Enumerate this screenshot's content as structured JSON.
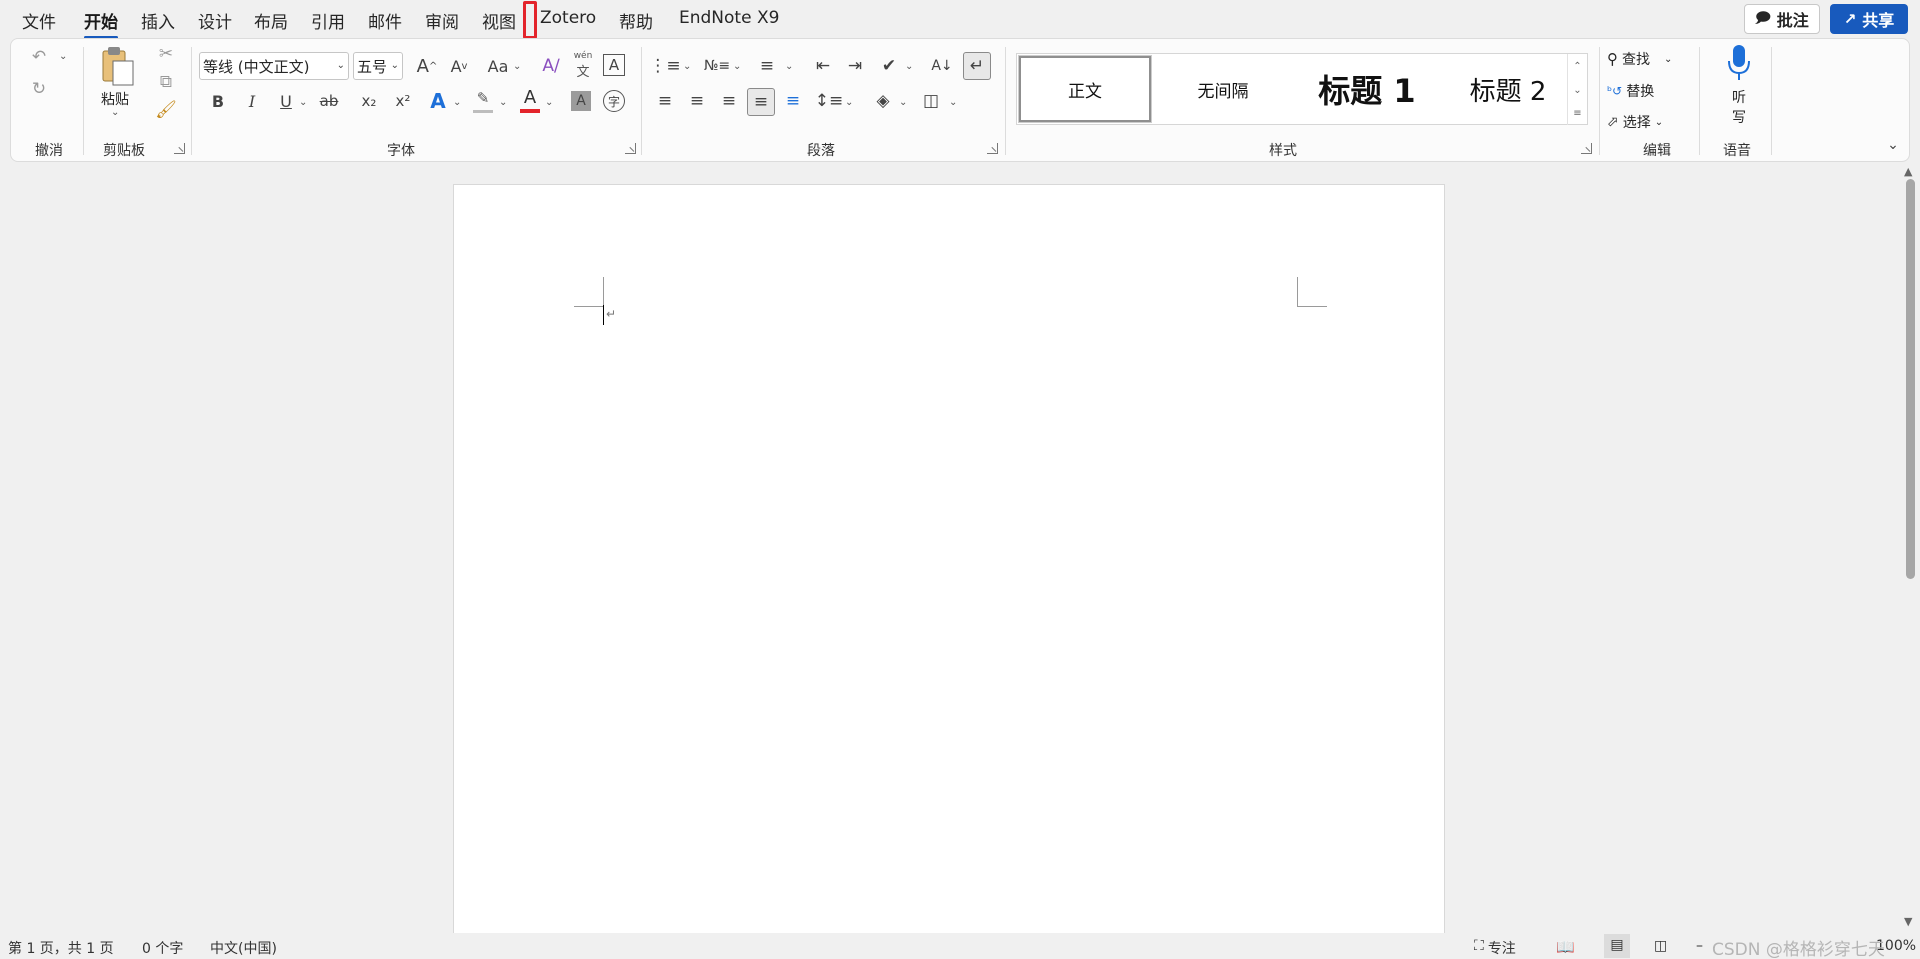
{
  "menu": {
    "tabs": [
      {
        "label": "文件"
      },
      {
        "label": "开始",
        "active": true
      },
      {
        "label": "插入"
      },
      {
        "label": "设计"
      },
      {
        "label": "布局"
      },
      {
        "label": "引用"
      },
      {
        "label": "邮件"
      },
      {
        "label": "审阅"
      },
      {
        "label": "视图"
      },
      {
        "label": "Zotero"
      },
      {
        "label": "帮助"
      },
      {
        "label": "EndNote X9"
      }
    ],
    "comment_label": "批注",
    "share_label": "共享"
  },
  "ribbon": {
    "undo_group": {
      "label": "撤消"
    },
    "clipboard": {
      "label": "剪贴板",
      "paste_label": "粘贴"
    },
    "font": {
      "label": "字体",
      "font_name": "等线 (中文正文)",
      "font_size": "五号",
      "change_case": "Aa",
      "phonetic_top": "wén",
      "phonetic_bottom": "文",
      "char_border": "A",
      "bold": "B",
      "italic": "I",
      "underline": "U",
      "strike": "ab",
      "subscript": "x₂",
      "superscript": "x²",
      "text_effects": "A",
      "font_color": "A",
      "char_shading": "A",
      "enclose": "字"
    },
    "paragraph": {
      "label": "段落"
    },
    "styles": {
      "label": "样式",
      "items": [
        {
          "label": "正文"
        },
        {
          "label": "无间隔"
        },
        {
          "label": "标题 1"
        },
        {
          "label": "标题 2"
        }
      ]
    },
    "editing": {
      "label": "编辑",
      "find": "查找",
      "replace": "替换",
      "select": "选择"
    },
    "voice": {
      "label": "语音",
      "dictate_line1": "听",
      "dictate_line2": "写"
    }
  },
  "document": {
    "para_mark": "↵"
  },
  "status": {
    "page": "第 1 页，共 1 页",
    "words": "0 个字",
    "language": "中文(中国)",
    "focus": "专注",
    "zoom": "100%"
  },
  "watermark": "CSDN @格格衫穿七天",
  "colors": {
    "accent": "#185abd",
    "marker": "#e3242b",
    "font_color_bar": "#e3242b",
    "highlight_bar": "#ffff00"
  }
}
